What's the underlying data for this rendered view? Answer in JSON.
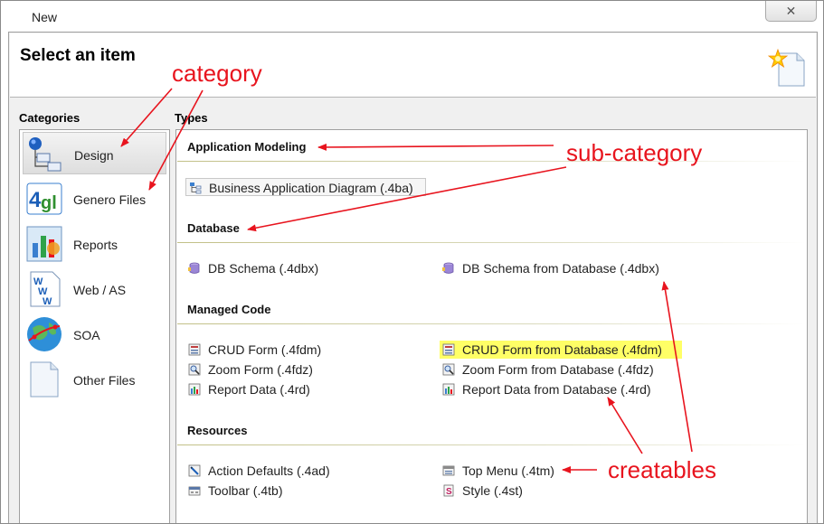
{
  "window": {
    "title": "New",
    "close_glyph": "✕"
  },
  "header": {
    "title": "Select an item",
    "icon": "new-item-wizard-icon"
  },
  "categories": {
    "label": "Categories",
    "items": [
      {
        "label": "Design",
        "icon": "design-icon",
        "selected": true
      },
      {
        "label": "Genero Files",
        "icon": "4gl-files-icon",
        "selected": false
      },
      {
        "label": "Reports",
        "icon": "reports-icon",
        "selected": false
      },
      {
        "label": "Web / AS",
        "icon": "web-as-icon",
        "selected": false
      },
      {
        "label": "SOA",
        "icon": "soa-globe-icon",
        "selected": false
      },
      {
        "label": "Other Files",
        "icon": "file-icon",
        "selected": false
      }
    ]
  },
  "types": {
    "label": "Types",
    "sections": [
      {
        "title": "Application Modeling",
        "items": [
          {
            "label": "Business Application Diagram (.4ba)",
            "icon": "diagram-icon"
          }
        ]
      },
      {
        "title": "Database",
        "items": [
          {
            "label": "DB Schema (.4dbx)",
            "icon": "db-schema-icon"
          },
          {
            "label": "DB Schema from Database (.4dbx)",
            "icon": "db-schema-icon"
          }
        ]
      },
      {
        "title": "Managed Code",
        "items": [
          {
            "label": "CRUD Form (.4fdm)",
            "icon": "form-icon"
          },
          {
            "label": "Zoom Form (.4fdz)",
            "icon": "zoom-form-icon"
          },
          {
            "label": "Report Data (.4rd)",
            "icon": "report-data-icon"
          },
          {
            "label": "CRUD Form from Database (.4fdm)",
            "icon": "form-icon",
            "highlighted": true,
            "highlight_color": "#ffff66"
          },
          {
            "label": "Zoom Form from Database (.4fdz)",
            "icon": "zoom-form-icon"
          },
          {
            "label": "Report Data from Database (.4rd)",
            "icon": "report-data-icon"
          }
        ]
      },
      {
        "title": "Resources",
        "items": [
          {
            "label": "Action Defaults (.4ad)",
            "icon": "action-defaults-icon"
          },
          {
            "label": "Toolbar (.4tb)",
            "icon": "toolbar-icon"
          },
          {
            "label": "Top Menu (.4tm)",
            "icon": "top-menu-icon"
          },
          {
            "label": "Style (.4st)",
            "icon": "style-icon"
          }
        ]
      }
    ]
  },
  "annotations": {
    "category": "category",
    "sub_category": "sub-category",
    "creatables": "creatables",
    "color": "#e8141e"
  }
}
